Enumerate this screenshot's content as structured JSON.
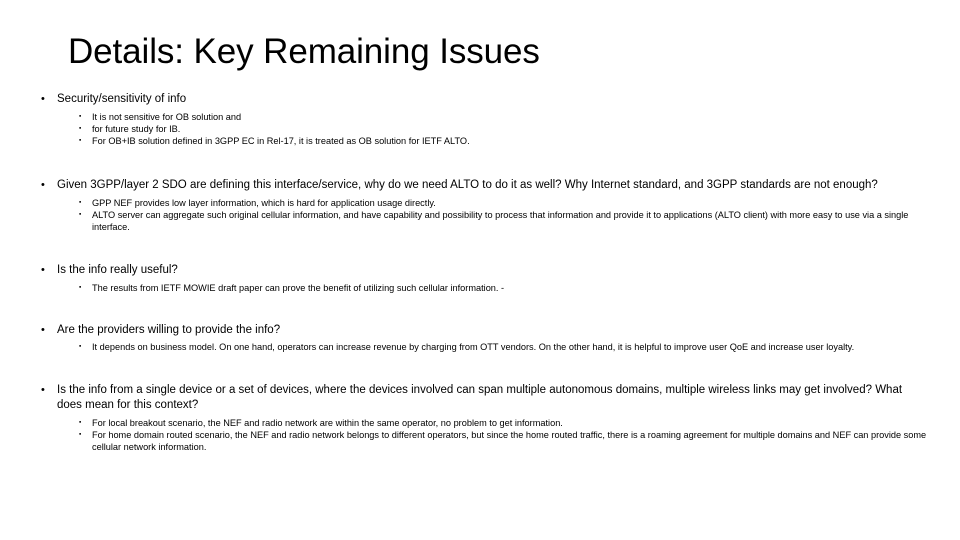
{
  "slide": {
    "title": "Details: Key Remaining Issues",
    "background_color": "#ffffff",
    "text_color": "#000000",
    "bullet_glyph_level1": "•",
    "bullet_glyph_level2": "▪",
    "groups": [
      {
        "heading": "Security/sensitivity of info",
        "subs": [
          "It is not sensitive for OB solution and",
          "for future study for IB.",
          " For OB+IB solution defined in 3GPP EC in Rel-17, it is treated as OB solution for IETF ALTO."
        ]
      },
      {
        "heading": "Given 3GPP/layer 2 SDO are defining this interface/service, why do we need ALTO to do it as well? Why Internet standard, and 3GPP standards are not enough?",
        "subs": [
          "GPP NEF provides low layer information, which is hard for application usage directly.",
          "ALTO server can aggregate such original cellular information, and have capability and possibility to process that information and provide it to applications (ALTO client) with more easy to use via a single interface."
        ]
      },
      {
        "heading": "Is the info really useful?",
        "subs": [
          "The results from IETF MOWIE draft paper can prove the benefit of utilizing such cellular information.  -"
        ]
      },
      {
        "heading": "Are the providers willing to provide the info?",
        "subs": [
          "It depends on business model. On one hand, operators can increase revenue by charging from OTT vendors. On the other hand, it is helpful to improve user QoE and increase user loyalty."
        ]
      },
      {
        "heading": "Is the info from a single device or a set of devices, where the devices involved can span multiple autonomous domains, multiple wireless links may get involved? What does mean for this context?",
        "subs": [
          "For local breakout scenario, the NEF and radio network are within the same operator, no problem to get information.",
          "For home domain routed scenario, the NEF and radio network belongs to different operators, but since the home routed traffic, there is a roaming agreement for multiple domains and NEF can provide some cellular network information."
        ]
      }
    ]
  }
}
